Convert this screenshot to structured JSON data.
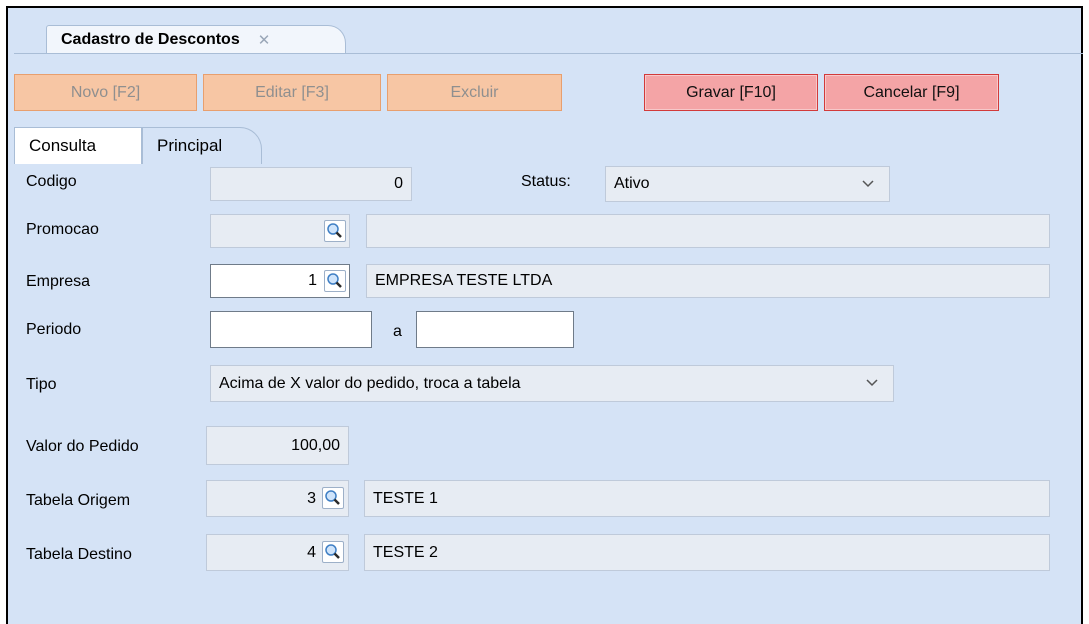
{
  "window": {
    "tab_title": "Cadastro de Descontos",
    "tab_close_icon": "close-icon"
  },
  "toolbar": {
    "novo_label": "Novo [F2]",
    "editar_label": "Editar [F3]",
    "excluir_label": "Excluir",
    "gravar_label": "Gravar [F10]",
    "cancelar_label": "Cancelar [F9]"
  },
  "tabs": [
    {
      "label": "Consulta"
    },
    {
      "label": "Principal"
    }
  ],
  "form": {
    "codigo": {
      "label": "Codigo",
      "value": "0"
    },
    "status": {
      "label": "Status:",
      "value": "Ativo"
    },
    "promocao": {
      "label": "Promocao",
      "value": "",
      "description": ""
    },
    "empresa": {
      "label": "Empresa",
      "value": "1",
      "description": "EMPRESA TESTE LTDA"
    },
    "periodo": {
      "label": "Periodo",
      "from": "",
      "separator": "a",
      "to": ""
    },
    "tipo": {
      "label": "Tipo",
      "value": "Acima de X valor do pedido, troca a tabela"
    },
    "valor_pedido": {
      "label": "Valor do Pedido",
      "value": "100,00"
    },
    "tabela_origem": {
      "label": "Tabela Origem",
      "value": "3",
      "description": "TESTE 1"
    },
    "tabela_destino": {
      "label": "Tabela Destino",
      "value": "4",
      "description": "TESTE 2"
    }
  },
  "colors": {
    "background": "#d5e3f6",
    "disabled_button": "#f7c6a4",
    "active_button": "#f4a4a6",
    "active_button_border": "#d23a3a"
  },
  "icons": [
    "close-icon",
    "search-lookup-icon",
    "chevron-down-icon"
  ]
}
